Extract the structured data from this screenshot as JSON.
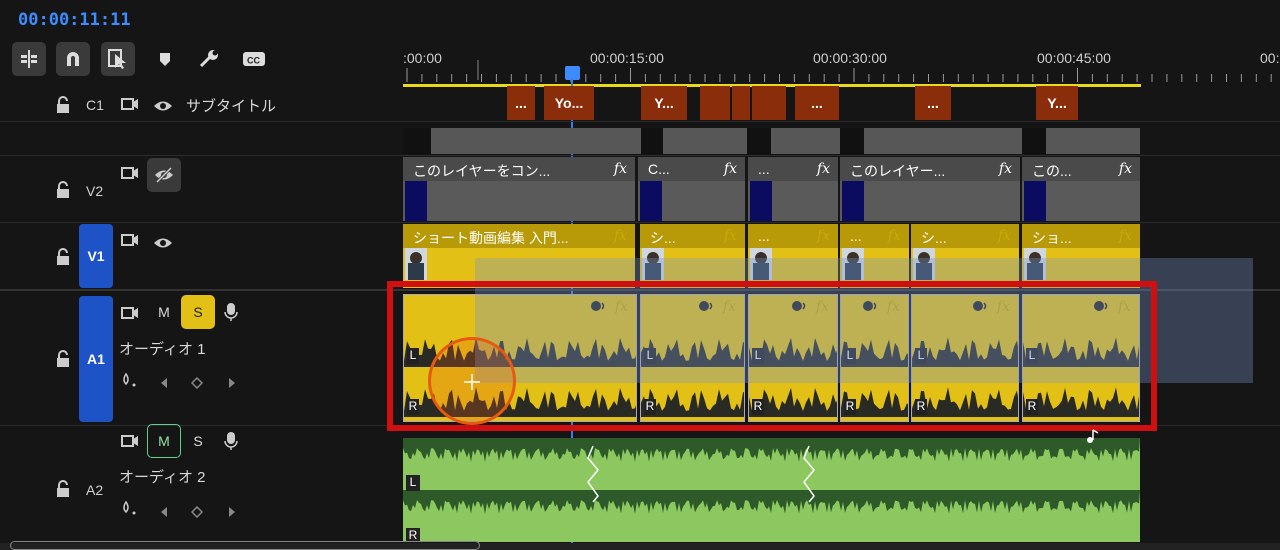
{
  "timecode": "00:00:11:11",
  "toolbar": {
    "icons": [
      "insert-sequence-icon",
      "snap-magnet-icon",
      "linked-selection-icon",
      "add-marker-icon",
      "settings-wrench-icon",
      "captions-icon"
    ]
  },
  "ruler": {
    "labels": [
      ":00:00",
      "00:00:15:00",
      "00:00:30:00",
      "00:00:45:00",
      "00:"
    ]
  },
  "tracks": {
    "c1": {
      "name": "C1",
      "label": "サブタイトル"
    },
    "v2": {
      "name": "V2"
    },
    "v1": {
      "name": "V1"
    },
    "a1": {
      "name": "A1",
      "label": "オーディオ 1",
      "m": "M",
      "s": "S"
    },
    "a2": {
      "name": "A2",
      "label": "オーディオ 2",
      "m": "M",
      "s": "S"
    }
  },
  "captions": [
    "...",
    "Yo...",
    "Y...",
    "",
    "",
    "",
    "...",
    "...",
    "Y..."
  ],
  "v2_clips": [
    "このレイヤーをコン...",
    "C...",
    "...",
    "このレイヤー...",
    "この..."
  ],
  "fx": "fx",
  "v1_clips": [
    "ショート動画編集 入門...",
    "シ...",
    "...",
    "...",
    "シ...",
    "ショ..."
  ],
  "audio_channels": {
    "left": "L",
    "right": "R"
  },
  "colors": {
    "accent": "#3c8cff",
    "video_clip": "#e3c015",
    "audio_clip": "#e3c015",
    "music_clip": "#8cc760",
    "highlight": "#d01010"
  }
}
